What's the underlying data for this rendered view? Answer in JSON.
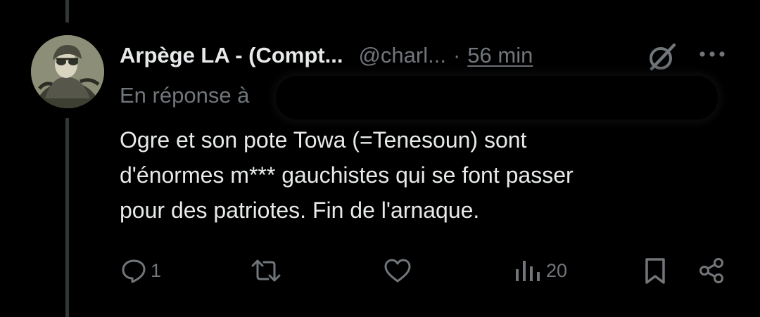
{
  "tweet": {
    "display_name": "Arpège LA - (Compt...",
    "handle": "@charl...",
    "separator": "·",
    "timestamp": "56 min",
    "reply_prefix": "En réponse à",
    "text": "Ogre et son pote Towa (=Tenesoun) sont\nd'énormes m*** gauchistes qui se font passer\npour des patriotes. Fin de l'arnaque."
  },
  "actions": {
    "reply_count": "1",
    "retweet_count": "",
    "like_count": "",
    "views_count": "20"
  },
  "icons": {
    "header": [
      "grok-icon",
      "more-icon"
    ],
    "actions": [
      "reply-icon",
      "retweet-icon",
      "like-icon",
      "views-icon",
      "bookmark-icon",
      "share-icon"
    ]
  },
  "colors": {
    "background": "#000000",
    "primary_text": "#e7e9ea",
    "secondary_text": "#71767b",
    "thread_line": "#333639"
  }
}
